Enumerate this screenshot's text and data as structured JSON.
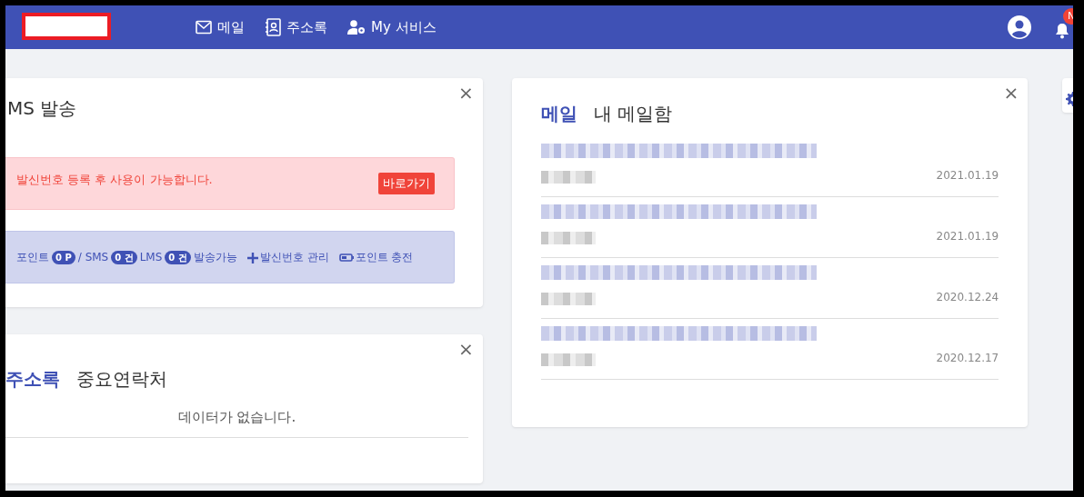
{
  "navbar": {
    "menu": [
      {
        "kind": "mail",
        "label": "메일"
      },
      {
        "kind": "contacts",
        "label": "주소록"
      },
      {
        "kind": "service",
        "label": "My 서비스"
      }
    ],
    "notification_badge": "N"
  },
  "sms_card": {
    "title": "MS 발송",
    "close": "×",
    "alert": {
      "message": "발신번호 등록 후 사용이 가능합니다.",
      "button": "바로가기"
    },
    "info": {
      "segments": [
        {
          "kind": "text",
          "text": "포인트"
        },
        {
          "kind": "badge",
          "text": "0 P"
        },
        {
          "kind": "text",
          "text": "/ SMS"
        },
        {
          "kind": "badge",
          "text": "0 건"
        },
        {
          "kind": "text",
          "text": "LMS"
        },
        {
          "kind": "badge",
          "text": "0 건"
        },
        {
          "kind": "text",
          "text": "발송가능"
        }
      ],
      "links": [
        {
          "kind": "add",
          "label": "발신번호 관리"
        },
        {
          "kind": "charge",
          "label": "포인트 충전"
        }
      ]
    }
  },
  "contacts_card": {
    "close": "×",
    "tabs": [
      {
        "label": "주소록",
        "selected": true
      },
      {
        "label": "중요연락처",
        "selected": false
      }
    ],
    "empty_message": "데이터가 없습니다."
  },
  "mail_card": {
    "close": "×",
    "tabs": [
      {
        "label": "메일",
        "selected": true
      },
      {
        "label": "내 메일함",
        "selected": false
      }
    ],
    "items": [
      {
        "date": "2021.01.19"
      },
      {
        "date": "2021.01.19"
      },
      {
        "date": "2020.12.24"
      },
      {
        "date": "2020.12.17"
      }
    ]
  }
}
